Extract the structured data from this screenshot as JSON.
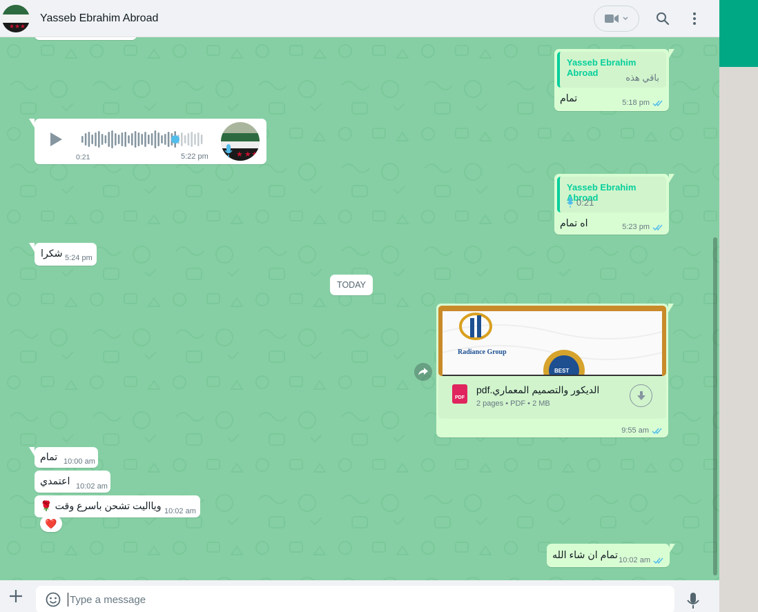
{
  "header": {
    "contact_name": "Yasseb Ebrahim Abroad"
  },
  "messages": {
    "reply1": {
      "quote_name": "Yasseb Ebrahim Abroad",
      "quote_text": "باقي هذه",
      "text": "تمام",
      "time": "5:18 pm"
    },
    "voice": {
      "duration": "0:21",
      "time": "5:22 pm"
    },
    "reply2": {
      "quote_name": "Yasseb Ebrahim Abroad",
      "quote_voice": "0:21",
      "text": "اه تمام",
      "time": "5:23 pm"
    },
    "thanks": {
      "text": "شكرا",
      "time": "5:24 pm"
    },
    "date_divider": "TODAY",
    "document": {
      "preview_brand": "Radiance Group",
      "preview_badge": "BEST",
      "file_name": "الديكور والتصميم المعماري.pdf",
      "file_icon": "PDF",
      "meta": "2 pages • PDF • 2 MB",
      "time": "9:55 am"
    },
    "m1": {
      "text": "تمام",
      "time": "10:00 am"
    },
    "m2": {
      "text": "اعتمدي",
      "time": "10:02 am"
    },
    "m3": {
      "text": "ويااليت تشحن باسرع وقت 🌹",
      "time": "10:02 am",
      "reaction": "❤️"
    },
    "m4": {
      "text": "تمام ان شاء الله",
      "time": "10:02 am"
    }
  },
  "composer": {
    "placeholder": "Type a message"
  },
  "colors": {
    "chat_bg": "#86cfa4",
    "outgoing": "#d9fdd3",
    "incoming": "#ffffff",
    "accent": "#00a884",
    "quote_name": "#06cf9c",
    "ticks": "#53bdeb"
  },
  "icons": [
    "video-call-icon",
    "search-icon",
    "menu-icon",
    "play-icon",
    "mic-icon",
    "forward-icon",
    "pdf-icon",
    "download-icon",
    "plus-icon",
    "emoji-icon",
    "double-check-icon"
  ]
}
